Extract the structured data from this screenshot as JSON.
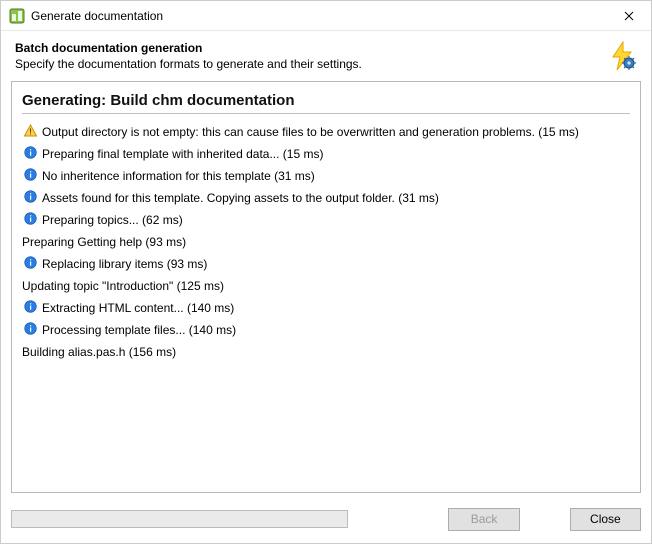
{
  "window": {
    "title": "Generate documentation"
  },
  "header": {
    "title": "Batch documentation generation",
    "subtitle": "Specify the documentation formats to generate and their settings."
  },
  "section": {
    "title": "Generating: Build chm documentation"
  },
  "log": [
    {
      "icon": "warning",
      "text": "Output directory is not empty: this can cause files to be overwritten and generation problems. (15 ms)"
    },
    {
      "icon": "info",
      "text": "Preparing final template with inherited data... (15 ms)"
    },
    {
      "icon": "info",
      "text": "No inheritence information for this template (31 ms)"
    },
    {
      "icon": "info",
      "text": "Assets found for this template. Copying assets to the output folder. (31 ms)"
    },
    {
      "icon": "info",
      "text": "Preparing topics... (62 ms)"
    },
    {
      "icon": "none",
      "text": "Preparing Getting help (93 ms)"
    },
    {
      "icon": "info",
      "text": "Replacing library items (93 ms)"
    },
    {
      "icon": "none",
      "text": "Updating topic \"Introduction\" (125 ms)"
    },
    {
      "icon": "info",
      "text": "Extracting HTML content... (140 ms)"
    },
    {
      "icon": "info",
      "text": "Processing template files... (140 ms)"
    },
    {
      "icon": "none",
      "text": "Building alias.pas.h (156 ms)"
    }
  ],
  "footer": {
    "back_label": "Back",
    "close_label": "Close"
  }
}
